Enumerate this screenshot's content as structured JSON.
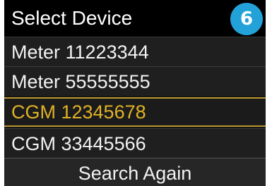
{
  "header": {
    "title": "Select Device",
    "step_badge": "6"
  },
  "device_list": {
    "items": [
      {
        "label": "Meter 11223344",
        "selected": false
      },
      {
        "label": "Meter 55555555",
        "selected": false
      },
      {
        "label": "CGM 12345678",
        "selected": true
      },
      {
        "label": "CGM 33445566",
        "selected": false
      }
    ]
  },
  "actions": {
    "search_again_label": "Search Again"
  },
  "colors": {
    "screen_background": "#161616",
    "title_background": "#000000",
    "selected_text": "#e0b227",
    "selected_border": "#b8972e",
    "badge_background": "#23a2d9"
  }
}
